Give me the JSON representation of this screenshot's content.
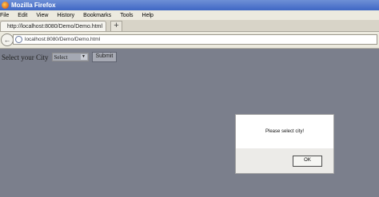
{
  "window": {
    "title": "Mozilla Firefox"
  },
  "menu": {
    "items": [
      "File",
      "Edit",
      "View",
      "History",
      "Bookmarks",
      "Tools",
      "Help"
    ]
  },
  "tab": {
    "title": "http://localhost:8080/Demo/Demo.html"
  },
  "address": {
    "url": "localhost:8080/Demo/Demo.html"
  },
  "form": {
    "label": "Select your City",
    "select_value": "Select",
    "submit_label": "Submit"
  },
  "dialog": {
    "message": "Please select city!",
    "ok_label": "OK"
  }
}
